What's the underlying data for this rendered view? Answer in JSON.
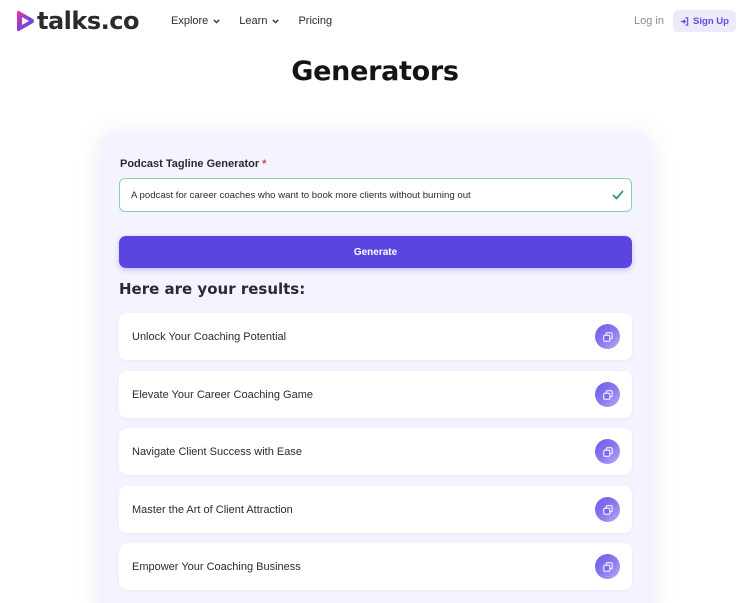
{
  "brand": {
    "name": "talks.co",
    "accent": "#5a45e0"
  },
  "nav": {
    "items": [
      {
        "label": "Explore",
        "has_dropdown": true
      },
      {
        "label": "Learn",
        "has_dropdown": true
      },
      {
        "label": "Pricing",
        "has_dropdown": false
      }
    ],
    "login_label": "Log in",
    "signup_label": "Sign Up"
  },
  "page": {
    "title": "Generators"
  },
  "generator": {
    "field_label": "Podcast Tagline Generator",
    "required_mark": "*",
    "input_value": "A podcast for career coaches who want to book more clients without burning out",
    "generate_label": "Generate",
    "results_heading": "Here are your results:",
    "results": [
      {
        "text": "Unlock Your Coaching Potential"
      },
      {
        "text": "Elevate Your Career Coaching Game"
      },
      {
        "text": "Navigate Client Success with Ease"
      },
      {
        "text": "Master the Art of Client Attraction"
      },
      {
        "text": "Empower Your Coaching Business"
      }
    ]
  },
  "icons": {
    "logo": "talks-play-icon",
    "dropdown": "chevron-down-icon",
    "signup": "sign-in-icon",
    "valid": "check-icon",
    "copy": "copy-icon"
  }
}
